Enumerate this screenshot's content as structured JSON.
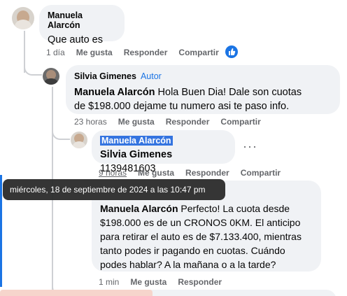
{
  "comments": [
    {
      "author": "Manuela Alarcón",
      "text": "Que auto es",
      "time": "1 día",
      "like_label": "Me gusta",
      "reply_label": "Responder",
      "share_label": "Compartir",
      "reaction": "like-icon"
    },
    {
      "author": "Silvia Gimenes",
      "badge": "Autor",
      "mention": "Manuela Alarcón",
      "text_line1": " Hola Buen Dia! Dale son cuotas",
      "text_line2": "de $198.000 dejame tu numero asi te paso info.",
      "time": "23 horas",
      "like_label": "Me gusta",
      "reply_label": "Responder",
      "share_label": "Compartir"
    },
    {
      "author": "Manuela Alarcón",
      "mention": "Silvia Gimenes",
      "text": " 1139481603",
      "time": "9 horas",
      "like_label": "Me gusta",
      "reply_label": "Responder",
      "share_label": "Compartir",
      "more_label": "···"
    },
    {
      "mention": "Manuela Alarcón",
      "text_line1": " Perfecto! La cuota desde",
      "text_line2": "$198.000 es de un CRONOS 0KM. El anticipo",
      "text_line3": "para retirar el auto es de $7.133.400, mientras",
      "text_line4": "tanto podes ir pagando en cuotas. Cuándo",
      "text_line5": "podes hablar? A la mañana o a la tarde?",
      "time": "1 min",
      "like_label": "Me gusta",
      "reply_label": "Responder"
    }
  ],
  "tooltip": "miércoles, 18 de septiembre de 2024 a las 10:47 pm",
  "colors": {
    "accent": "#1b74e4",
    "bubble": "#f0f2f5",
    "meta": "#65676b",
    "tooltip_bg": "#282828"
  }
}
